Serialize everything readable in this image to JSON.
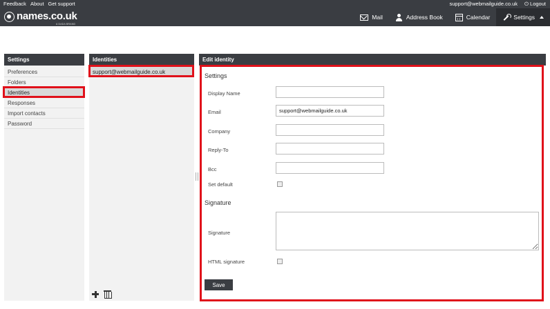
{
  "top_links": [
    "Feedback",
    "About",
    "Get support"
  ],
  "user": {
    "email": "support@webmailguide.co.uk",
    "logout_label": "Logout"
  },
  "logo": {
    "text": "names.co.uk",
    "subtext": "A DADA BRAND"
  },
  "nav": [
    {
      "label": "Mail",
      "icon": "mail-icon"
    },
    {
      "label": "Address Book",
      "icon": "address-book-icon"
    },
    {
      "label": "Calendar",
      "icon": "calendar-icon"
    },
    {
      "label": "Settings",
      "icon": "wrench-icon"
    }
  ],
  "settings_panel": {
    "title": "Settings",
    "items": [
      "Preferences",
      "Folders",
      "Identities",
      "Responses",
      "Import contacts",
      "Password"
    ],
    "selected": "Identities"
  },
  "identities_panel": {
    "title": "Identities",
    "items": [
      "support@webmailguide.co.uk"
    ]
  },
  "edit_panel": {
    "title": "Edit identity",
    "settings_section": "Settings",
    "fields": [
      {
        "label": "Display Name",
        "value": ""
      },
      {
        "label": "Email",
        "value": "support@webmailguide.co.uk"
      },
      {
        "label": "Company",
        "value": ""
      },
      {
        "label": "Reply-To",
        "value": ""
      },
      {
        "label": "Bcc",
        "value": ""
      }
    ],
    "set_default_label": "Set default",
    "signature_section": "Signature",
    "signature_label": "Signature",
    "signature_value": "",
    "html_signature_label": "HTML signature",
    "save_label": "Save"
  },
  "colors": {
    "dark_bar": "#3a3d42",
    "highlight": "#e0101a"
  }
}
